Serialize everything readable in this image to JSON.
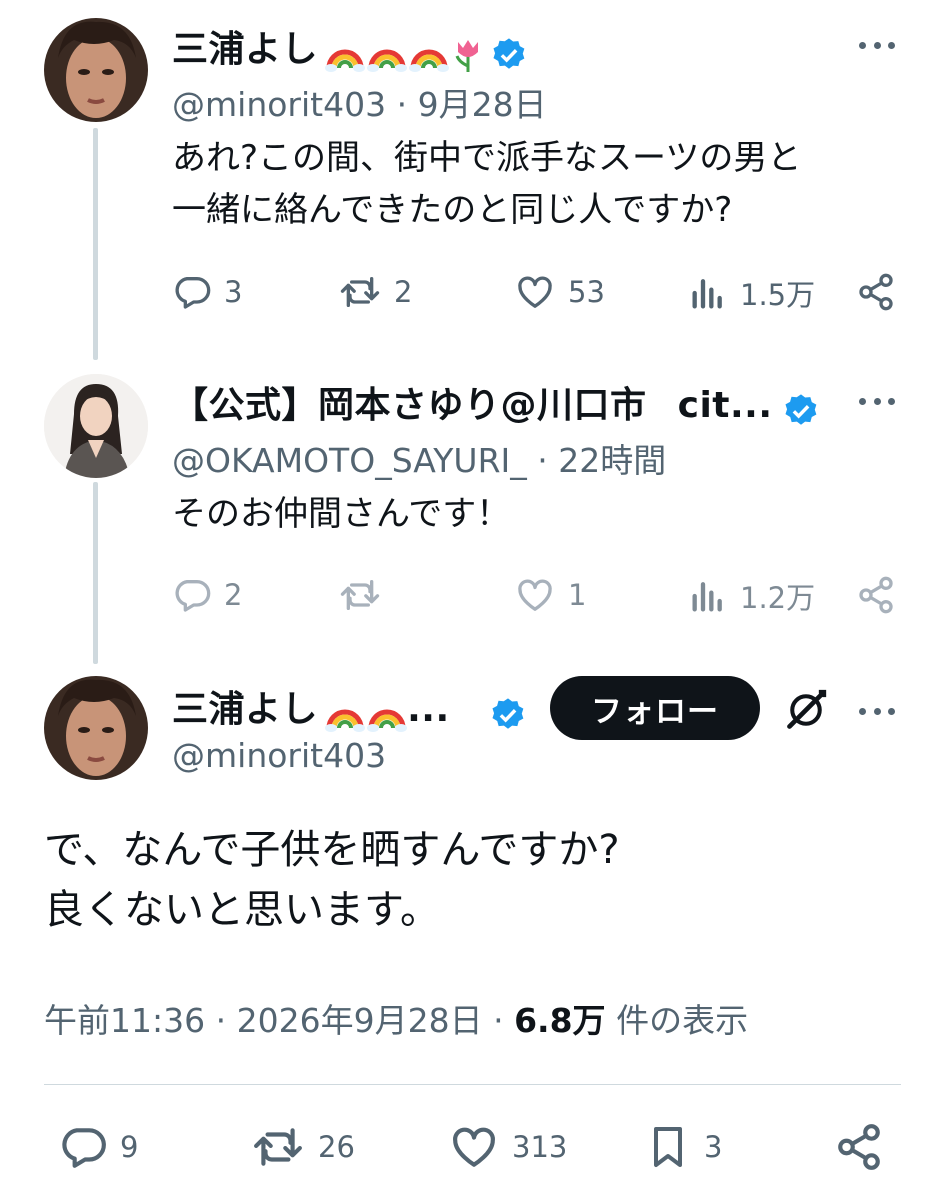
{
  "tweet1": {
    "name": "三浦よし",
    "handle": "@minorit403",
    "sep": "·",
    "date": "9月28日",
    "text_line1": "あれ?この間、街中で派手なスーツの男と",
    "text_line2": "一緒に絡んできたのと同じ人ですか?",
    "replies": "3",
    "retweets": "2",
    "likes": "53",
    "views": "1.5万"
  },
  "tweet2": {
    "name": "【公式】岡本さゆり@川口市",
    "name_tail": "cit...",
    "handle": "@OKAMOTO_SAYURI_",
    "sep": "·",
    "time": "22時間",
    "text": "そのお仲間さんです！",
    "replies": "2",
    "retweets": "",
    "likes": "1",
    "views": "1.2万"
  },
  "main": {
    "name": "三浦よし",
    "name_ellipsis": "...",
    "handle": "@minorit403",
    "follow_label": "フォロー",
    "text_line1": "で、なんで子供を晒すんですか?",
    "text_line2": "良くないと思います。",
    "time": "午前11:36",
    "sep": "·",
    "date": "2026年9月28日",
    "sep2": "·",
    "views_count": "6.8万",
    "views_label": "件の表示",
    "replies": "9",
    "retweets": "26",
    "likes": "313",
    "bookmarks": "3"
  },
  "colors": {
    "text": "#0f1419",
    "secondary": "#536471",
    "verified": "#1d9bf0",
    "line": "#cfd9de"
  },
  "icons": [
    "rainbow-emoji",
    "tulip-emoji",
    "verified-badge-icon",
    "more-icon",
    "reply-icon",
    "retweet-icon",
    "like-icon",
    "views-icon",
    "share-icon",
    "bookmark-icon",
    "grok-icon"
  ]
}
